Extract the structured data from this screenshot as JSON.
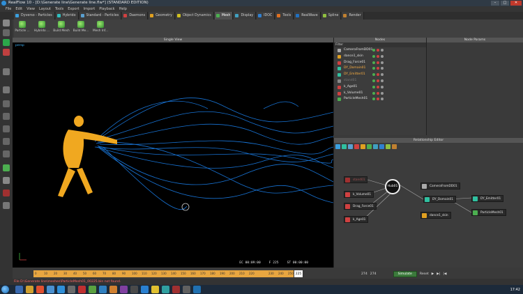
{
  "window": {
    "title": "RealFlow 10 - [D:\\Generate line\\Generate line.flw*] (STANDARD EDITION)"
  },
  "menu": [
    "File",
    "Edit",
    "View",
    "Layout",
    "Tools",
    "Export",
    "Import",
    "Playback",
    "Help"
  ],
  "tabs": [
    {
      "label": "Dyverso - Particles",
      "color": "#3aa0e0"
    },
    {
      "label": "Hybrido",
      "color": "#2fbfbf"
    },
    {
      "label": "Standard - Particles",
      "color": "#5aa0d0"
    },
    {
      "label": "Daemons",
      "color": "#d04040"
    },
    {
      "label": "Geometry",
      "color": "#e0a020"
    },
    {
      "label": "Object Dynamics",
      "color": "#d0c020"
    },
    {
      "label": "Mesh",
      "color": "#4caf50",
      "active": true
    },
    {
      "label": "Display",
      "color": "#40a0c0"
    },
    {
      "label": "IDOC",
      "color": "#3080d0"
    },
    {
      "label": "Tools",
      "color": "#e07020"
    },
    {
      "label": "RealWave",
      "color": "#2070c0"
    },
    {
      "label": "Spline",
      "color": "#90c040"
    },
    {
      "label": "Render",
      "color": "#c08030"
    }
  ],
  "shelf": [
    "Particle ...",
    "Hybrido ...",
    "Build Mesh",
    "Build Me...",
    "Mesh Inf..."
  ],
  "viewport": {
    "title": "Single View",
    "camera": "persp",
    "ec": "EC 00:09:00",
    "f": "F 225",
    "st": "ST 00:00:00"
  },
  "nodes_panel": {
    "title": "Nodes",
    "filter": "Filter",
    "items": [
      {
        "name": "CameraFromDD01",
        "color": "#aaaaaa"
      },
      {
        "name": "dance1_skin",
        "color": "#e0a020"
      },
      {
        "name": "Drag_Force01",
        "color": "#d04040"
      },
      {
        "name": "DY_Domain01",
        "color": "#30c0a0",
        "highlight": true
      },
      {
        "name": "DY_Emitter01",
        "color": "#30c0a0",
        "highlight": true
      },
      {
        "name": "stand01",
        "color": "#888888",
        "dim": true
      },
      {
        "name": "k_Age01",
        "color": "#d04040"
      },
      {
        "name": "k_Volume01",
        "color": "#d04040"
      },
      {
        "name": "ParticleMesh01",
        "color": "#4caf50"
      }
    ]
  },
  "params_panel": {
    "title": "Node Params"
  },
  "relationship": {
    "title": "Relationship Editor",
    "hub": "Hub01",
    "nodes": [
      {
        "name": "stand01",
        "color": "#c04040"
      },
      {
        "name": "k_Volume01",
        "color": "#d04040"
      },
      {
        "name": "Drag_Force01",
        "color": "#d04040"
      },
      {
        "name": "k_Age01",
        "color": "#d04040"
      },
      {
        "name": "CameraFromDD01",
        "color": "#aaaaaa"
      },
      {
        "name": "DY_Domain01",
        "color": "#30c0a0"
      },
      {
        "name": "DY_Emitter01",
        "color": "#30c0a0"
      },
      {
        "name": "dance1_skin",
        "color": "#e0a020"
      },
      {
        "name": "ParticleMesh01",
        "color": "#4caf50"
      }
    ]
  },
  "timeline": {
    "ticks": [
      "0",
      "10",
      "20",
      "30",
      "40",
      "50",
      "60",
      "70",
      "80",
      "90",
      "100",
      "110",
      "120",
      "130",
      "140",
      "150",
      "160",
      "170",
      "180",
      "190",
      "200",
      "210",
      "220",
      "225",
      "230",
      "240",
      "250",
      "260",
      "270"
    ],
    "current": "225",
    "start": "274",
    "end": "274",
    "simulate": "Simulate",
    "reset": "Reset"
  },
  "status": {
    "message": "File D:\\Generate line\\meshes\\ParticleMesh01_00225.bin not found."
  },
  "clock": "17:42"
}
